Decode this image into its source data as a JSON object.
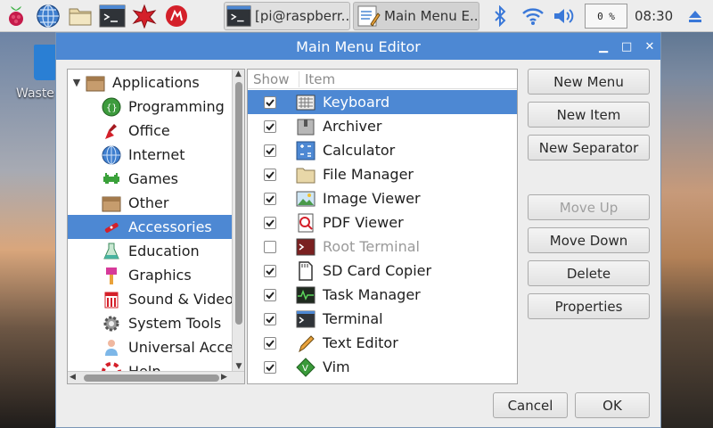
{
  "desktop": {
    "trash_label": "Waste"
  },
  "panel": {
    "launchers": [
      "raspberry-menu-icon",
      "web-browser-icon",
      "file-manager-icon",
      "terminal-icon",
      "mathematica-icon",
      "wolfram-icon"
    ],
    "tasks": [
      {
        "label": "[pi@raspberr...",
        "icon": "terminal-icon"
      },
      {
        "label": "Main Menu E...",
        "icon": "menu-editor-icon"
      }
    ],
    "tray": [
      "bluetooth-icon",
      "wifi-icon",
      "volume-icon"
    ],
    "cpu_label": "0 %",
    "clock": "08:30"
  },
  "window": {
    "title": "Main Menu Editor",
    "tree": [
      {
        "label": "Applications",
        "icon": "folder-icon",
        "level": 0,
        "expander": "▼"
      },
      {
        "label": "Programming",
        "icon": "programming-icon",
        "level": 1
      },
      {
        "label": "Office",
        "icon": "office-icon",
        "level": 1
      },
      {
        "label": "Internet",
        "icon": "internet-icon",
        "level": 1
      },
      {
        "label": "Games",
        "icon": "games-icon",
        "level": 1
      },
      {
        "label": "Other",
        "icon": "other-icon",
        "level": 1
      },
      {
        "label": "Accessories",
        "icon": "accessories-icon",
        "level": 1,
        "selected": true
      },
      {
        "label": "Education",
        "icon": "education-icon",
        "level": 1
      },
      {
        "label": "Graphics",
        "icon": "graphics-icon",
        "level": 1
      },
      {
        "label": "Sound & Video",
        "icon": "sound-video-icon",
        "level": 1
      },
      {
        "label": "System Tools",
        "icon": "system-tools-icon",
        "level": 1
      },
      {
        "label": "Universal Access",
        "icon": "universal-access-icon",
        "level": 1
      },
      {
        "label": "Help",
        "icon": "help-icon",
        "level": 1
      }
    ],
    "list_headers": {
      "show": "Show",
      "item": "Item"
    },
    "items": [
      {
        "label": "Keyboard",
        "checked": true,
        "icon": "keyboard-icon",
        "selected": true
      },
      {
        "label": "Archiver",
        "checked": true,
        "icon": "archiver-icon"
      },
      {
        "label": "Calculator",
        "checked": true,
        "icon": "calculator-icon"
      },
      {
        "label": "File Manager",
        "checked": true,
        "icon": "file-manager-icon"
      },
      {
        "label": "Image Viewer",
        "checked": true,
        "icon": "image-viewer-icon"
      },
      {
        "label": "PDF Viewer",
        "checked": true,
        "icon": "pdf-viewer-icon"
      },
      {
        "label": "Root Terminal",
        "checked": false,
        "icon": "root-terminal-icon",
        "disabled": true
      },
      {
        "label": "SD Card Copier",
        "checked": true,
        "icon": "sd-card-icon"
      },
      {
        "label": "Task Manager",
        "checked": true,
        "icon": "task-manager-icon"
      },
      {
        "label": "Terminal",
        "checked": true,
        "icon": "terminal-icon"
      },
      {
        "label": "Text Editor",
        "checked": true,
        "icon": "text-editor-icon"
      },
      {
        "label": "Vim",
        "checked": true,
        "icon": "vim-icon"
      }
    ],
    "buttons": {
      "new_menu": "New Menu",
      "new_item": "New Item",
      "new_separator": "New Separator",
      "move_up": "Move Up",
      "move_down": "Move Down",
      "delete": "Delete",
      "properties": "Properties",
      "cancel": "Cancel",
      "ok": "OK"
    }
  },
  "colors": {
    "accent": "#4d88d3",
    "panel_bg": "#ededed"
  }
}
